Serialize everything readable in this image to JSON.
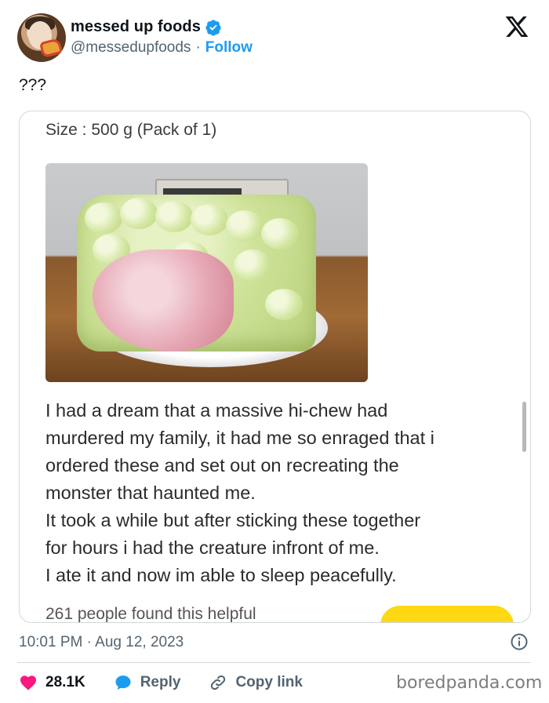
{
  "author": {
    "display_name": "messed up foods",
    "handle": "@messedupfoods",
    "separator": "·",
    "follow_label": "Follow",
    "verified_icon": "verified-badge-icon",
    "verified_color": "#1d9bf0"
  },
  "tweet": {
    "text": "???"
  },
  "media": {
    "size_label": "Size : 500 g (Pack of 1)",
    "review_lines": [
      "I had a dream that a massive hi-chew had",
      "murdered my family, it had me so enraged that i",
      "ordered these and set out on recreating the",
      "monster that haunted me.",
      "It took a while but after sticking these together",
      "for hours i had the creature infront of me.",
      "I ate it and now im able to sleep peacefully."
    ],
    "helpful_text": "261 people found this helpful",
    "button_color": "#ffd814"
  },
  "footer": {
    "timestamp": "10:01 PM · Aug 12, 2023",
    "likes": "28.1K",
    "reply_label": "Reply",
    "copy_link_label": "Copy link",
    "like_color": "#f91880",
    "reply_color": "#1d9bf0"
  },
  "watermark": "boredpanda.com"
}
